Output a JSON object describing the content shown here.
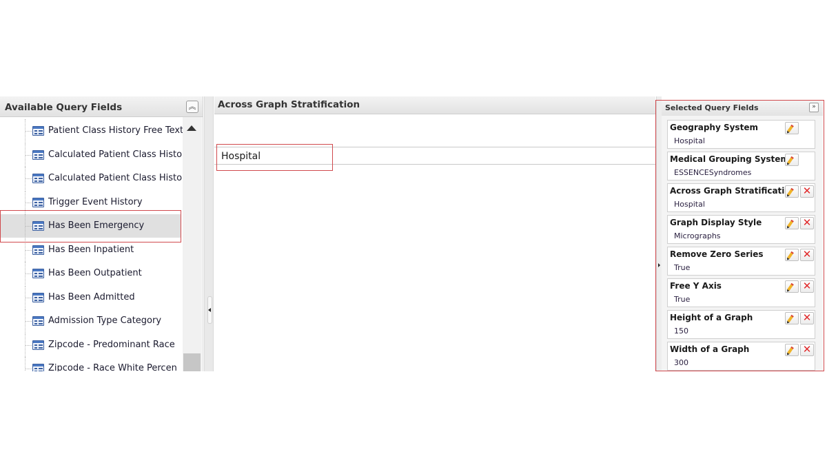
{
  "left_panel": {
    "title": "Available Query Fields",
    "collapse_icon": "double-chevron-up-icon",
    "items": [
      {
        "label": "Patient Class History Free Text",
        "icon": "field-list-icon",
        "selected": false
      },
      {
        "label": "Calculated Patient Class Histo...",
        "icon": "field-list-icon",
        "selected": false
      },
      {
        "label": "Calculated Patient Class Histo...",
        "icon": "field-list-icon",
        "selected": false
      },
      {
        "label": "Trigger Event History",
        "icon": "field-list-icon",
        "selected": false
      },
      {
        "label": "Has Been Emergency",
        "icon": "field-list-icon",
        "selected": true
      },
      {
        "label": "Has Been Inpatient",
        "icon": "field-list-icon",
        "selected": false
      },
      {
        "label": "Has Been Outpatient",
        "icon": "field-list-icon",
        "selected": false
      },
      {
        "label": "Has Been Admitted",
        "icon": "field-list-icon",
        "selected": false
      },
      {
        "label": "Admission Type Category",
        "icon": "field-list-icon",
        "selected": false
      },
      {
        "label": "Zipcode - Predominant Race",
        "icon": "field-list-icon",
        "selected": false
      },
      {
        "label": "Zipcode - Race White Percen",
        "icon": "field-list-icon",
        "selected": false
      }
    ]
  },
  "center": {
    "title": "Across Graph Stratification",
    "value": "Hospital"
  },
  "right_panel": {
    "title": "Selected Query Fields",
    "expand_icon": "double-chevron-right-icon",
    "fields": [
      {
        "title": "Geography System",
        "value": "Hospital",
        "editable": true,
        "removable": false
      },
      {
        "title": "Medical Grouping System",
        "value": "ESSENCESyndromes",
        "editable": true,
        "removable": false
      },
      {
        "title": "Across Graph Stratification",
        "value": "Hospital",
        "editable": true,
        "removable": true
      },
      {
        "title": "Graph Display Style",
        "value": "Micrographs",
        "editable": true,
        "removable": true
      },
      {
        "title": "Remove Zero Series",
        "value": "True",
        "editable": true,
        "removable": true
      },
      {
        "title": "Free Y Axis",
        "value": "True",
        "editable": true,
        "removable": true
      },
      {
        "title": "Height of a Graph",
        "value": "150",
        "editable": true,
        "removable": true
      },
      {
        "title": "Width of a Graph",
        "value": "300",
        "editable": true,
        "removable": true
      }
    ]
  },
  "colors": {
    "highlight": "#d0484c",
    "selected_row": "#e0e0e0",
    "delete": "#e0282a",
    "edit": "#f0b429"
  },
  "glyphs": {
    "collapse": "︽",
    "expand": "»",
    "delete": "✕"
  }
}
